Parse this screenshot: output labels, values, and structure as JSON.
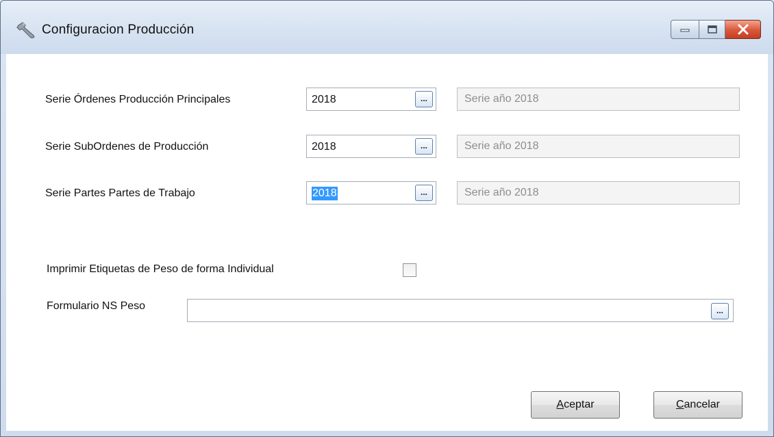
{
  "window": {
    "title": "Configuracion  Producción",
    "icon": "wrench-icon"
  },
  "form": {
    "rows": [
      {
        "label": "Serie Órdenes Producción Principales",
        "value": "2018",
        "description": "Serie año 2018"
      },
      {
        "label": "Serie SubOrdenes de Producción",
        "value": "2018",
        "description": "Serie año 2018"
      },
      {
        "label": "Serie Partes Partes de Trabajo",
        "value": "2018",
        "description": "Serie año 2018",
        "selected": true
      }
    ],
    "lookup_label": "...",
    "print_individual_label": "Imprimir Etiquetas de Peso de forma Individual",
    "print_individual_checked": false,
    "formulario_label": "Formulario NS Peso",
    "formulario_value": ""
  },
  "buttons": {
    "accept_mnemonic": "A",
    "accept_rest": "ceptar",
    "cancel_mnemonic": "C",
    "cancel_rest": "ancelar"
  },
  "colors": {
    "selection": "#3399ff",
    "close_button": "#d9573a"
  }
}
